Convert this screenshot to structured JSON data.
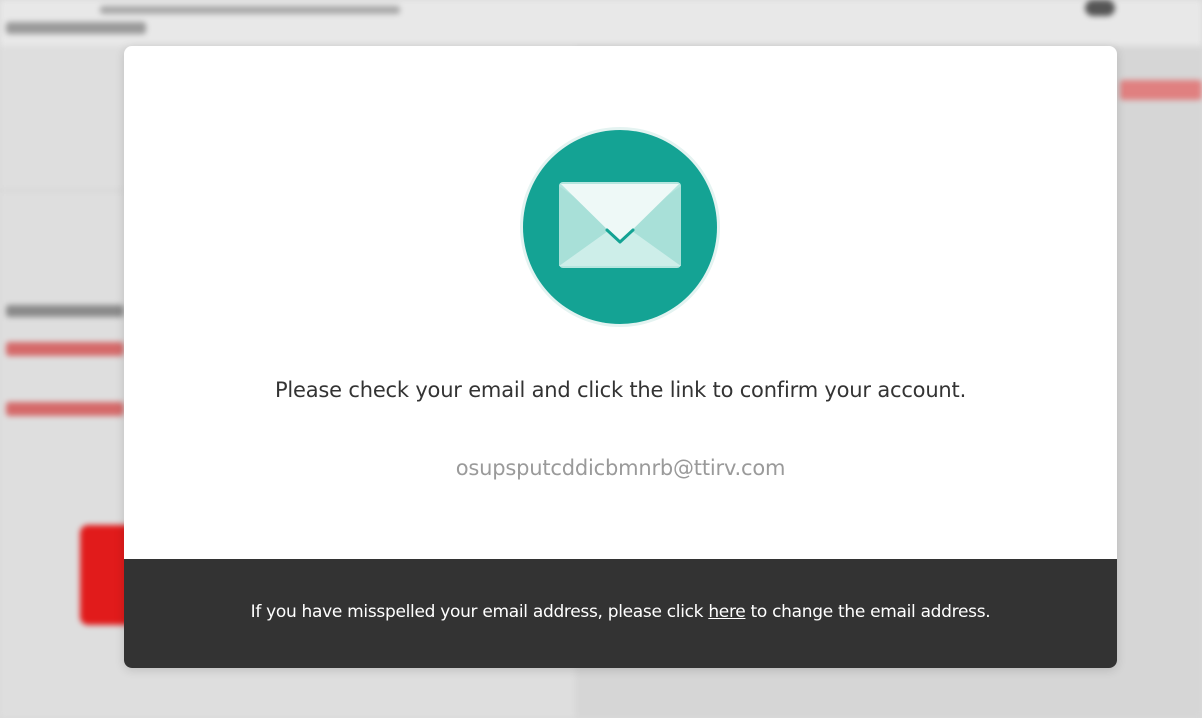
{
  "modal": {
    "message": "Please check your email and click the link to confirm your account.",
    "email": "osupsputcddicbmnrb@ttirv.com",
    "footer": {
      "text_before": "If you have misspelled your email address, please click ",
      "link_label": "here",
      "text_after": " to change the email address."
    },
    "icon": "envelope-icon"
  },
  "colors": {
    "accent": "#14a394",
    "footer_bg": "#333333",
    "brand_red": "#e11b1b"
  }
}
